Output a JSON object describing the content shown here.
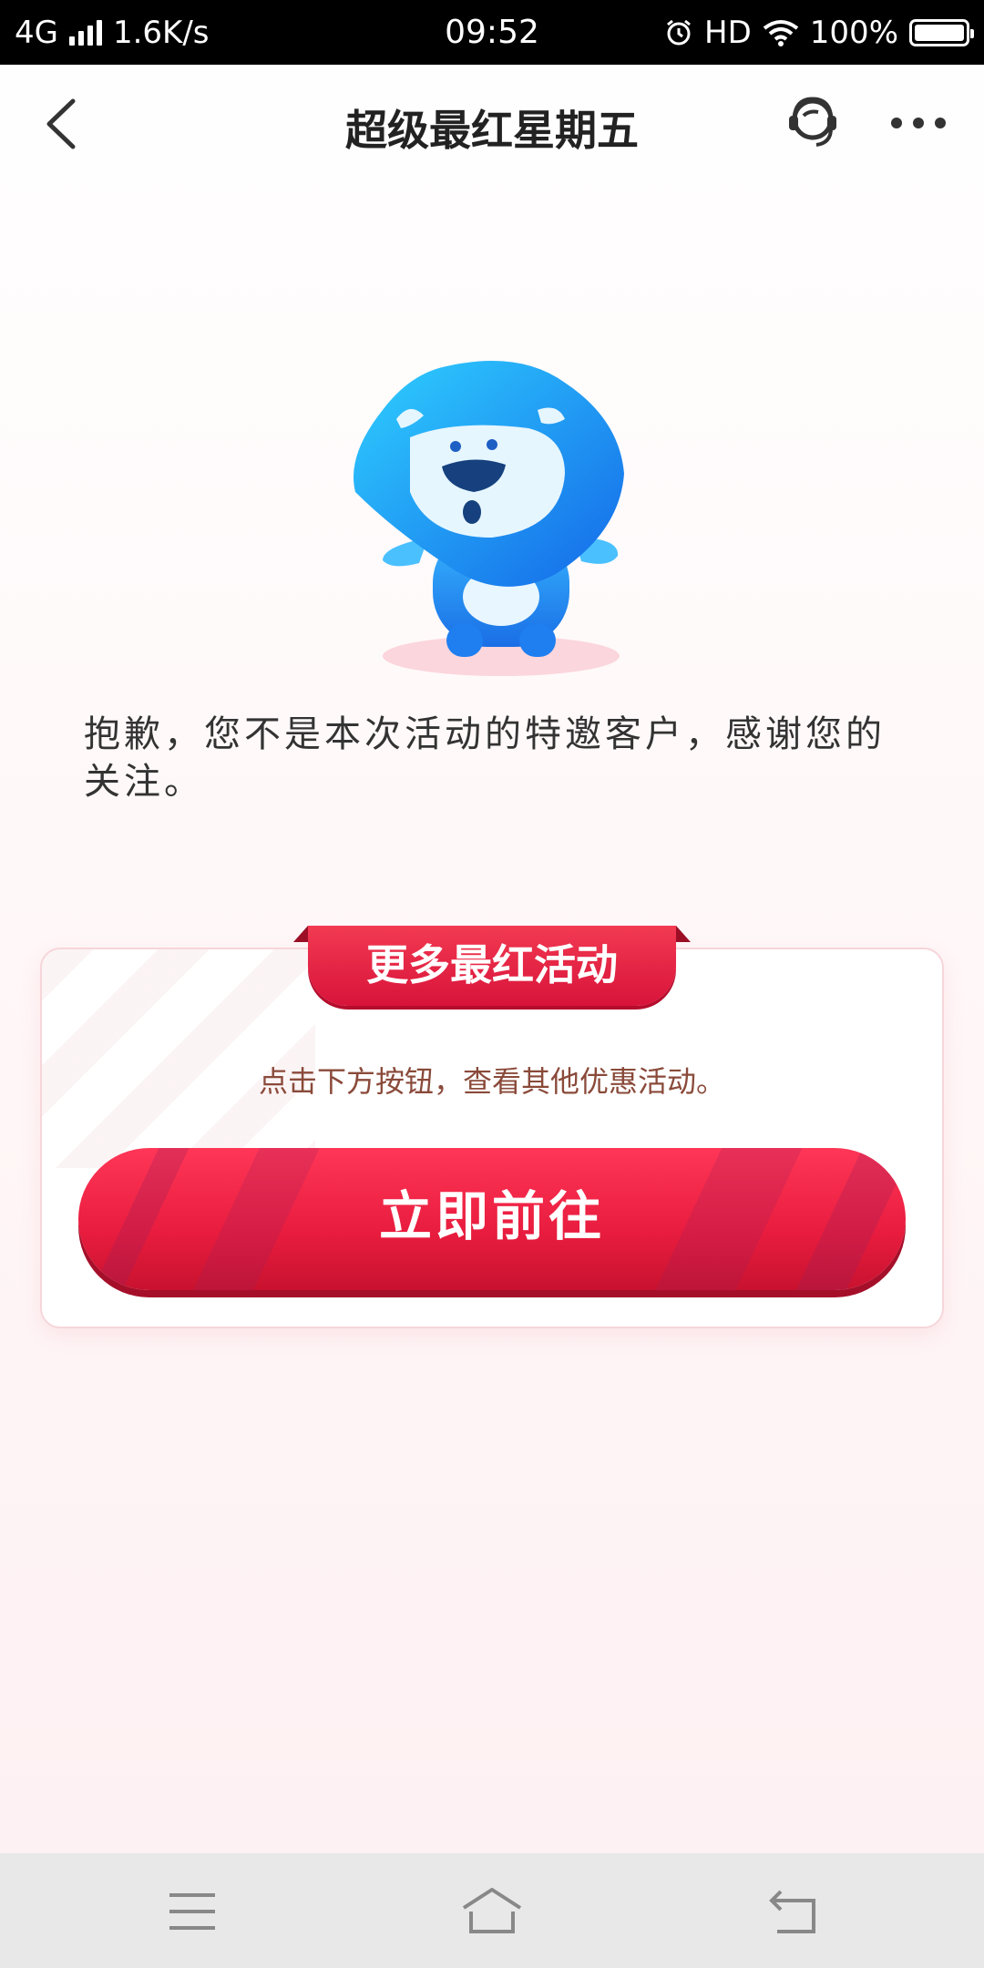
{
  "status_bar": {
    "network": "4G",
    "speed": "1.6K/s",
    "time": "09:52",
    "hd": "HD",
    "battery": "100%"
  },
  "nav": {
    "title": "超级最红星期五"
  },
  "message": {
    "text": "抱歉，您不是本次活动的特邀客户，感谢您的关注。"
  },
  "card": {
    "ribbon_title": "更多最红活动",
    "hint": "点击下方按钮，查看其他优惠活动。",
    "button_label": "立即前往"
  },
  "colors": {
    "accent": "#e81c3e",
    "mascot_blue": "#1e8cf0"
  },
  "icons": {
    "back": "chevron-left-icon",
    "customer_service": "customer-service-icon",
    "more": "more-dots-icon",
    "alarm": "alarm-icon",
    "wifi": "wifi-icon"
  }
}
